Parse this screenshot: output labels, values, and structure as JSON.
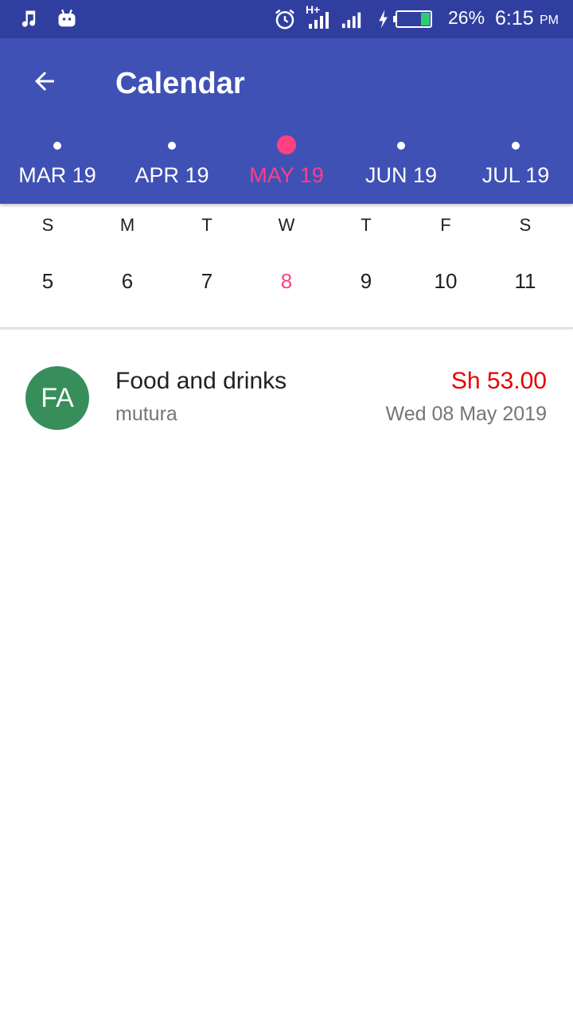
{
  "status_bar": {
    "battery_percent": "26%",
    "time": "6:15",
    "ampm": "PM",
    "network": "H+",
    "icons": [
      "music-note-icon",
      "android-icon",
      "alarm-icon",
      "signal-icon",
      "charging-icon",
      "battery-icon"
    ]
  },
  "app_bar": {
    "title": "Calendar",
    "back_icon": "arrow-back-icon"
  },
  "months": [
    {
      "label": "MAR 19",
      "selected": false
    },
    {
      "label": "APR 19",
      "selected": false
    },
    {
      "label": "MAY 19",
      "selected": true
    },
    {
      "label": "JUN 19",
      "selected": false
    },
    {
      "label": "JUL 19",
      "selected": false
    }
  ],
  "week": {
    "weekdays": [
      "S",
      "M",
      "T",
      "W",
      "T",
      "F",
      "S"
    ],
    "days": [
      "5",
      "6",
      "7",
      "8",
      "9",
      "10",
      "11"
    ],
    "selected_day": "8"
  },
  "entries": [
    {
      "avatar_initials": "FA",
      "title": "Food and drinks",
      "subtitle": "mutura",
      "amount": "Sh 53.00",
      "date": "Wed 08 May 2019"
    }
  ],
  "colors": {
    "status_bar": "#303f9f",
    "primary": "#3f51b5",
    "accent": "#ff4081",
    "amount": "#e60000",
    "avatar": "#388e5a"
  }
}
